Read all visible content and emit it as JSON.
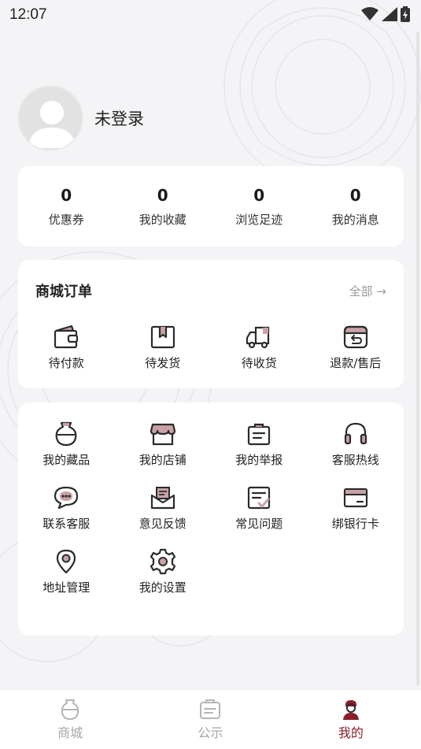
{
  "status_bar": {
    "time": "12:07"
  },
  "profile": {
    "name": "未登录"
  },
  "stats": [
    {
      "value": "0",
      "label": "优惠券"
    },
    {
      "value": "0",
      "label": "我的收藏"
    },
    {
      "value": "0",
      "label": "浏览足迹"
    },
    {
      "value": "0",
      "label": "我的消息"
    }
  ],
  "orders": {
    "title": "商城订单",
    "all_label": "全部 →",
    "items": [
      {
        "label": "待付款",
        "icon": "wallet-icon"
      },
      {
        "label": "待发货",
        "icon": "package-icon"
      },
      {
        "label": "待收货",
        "icon": "truck-icon"
      },
      {
        "label": "退款/售后",
        "icon": "refund-icon"
      }
    ]
  },
  "services": {
    "items": [
      {
        "label": "我的藏品",
        "icon": "vase-icon"
      },
      {
        "label": "我的店铺",
        "icon": "shop-icon"
      },
      {
        "label": "我的举报",
        "icon": "report-icon"
      },
      {
        "label": "客服热线",
        "icon": "headset-icon"
      },
      {
        "label": "联系客服",
        "icon": "chat-icon"
      },
      {
        "label": "意见反馈",
        "icon": "feedback-icon"
      },
      {
        "label": "常见问题",
        "icon": "faq-icon"
      },
      {
        "label": "绑银行卡",
        "icon": "bank-card-icon"
      },
      {
        "label": "地址管理",
        "icon": "location-icon"
      },
      {
        "label": "我的设置",
        "icon": "settings-icon"
      }
    ]
  },
  "tabbar": {
    "items": [
      {
        "label": "商城",
        "icon": "mall-icon",
        "active": false
      },
      {
        "label": "公示",
        "icon": "notice-icon",
        "active": false
      },
      {
        "label": "我的",
        "icon": "profile-icon",
        "active": true
      }
    ]
  },
  "colors": {
    "accent": "#8a1e2b",
    "icon_accent": "#c9a2a5",
    "icon_stroke": "#2b2b2b"
  }
}
